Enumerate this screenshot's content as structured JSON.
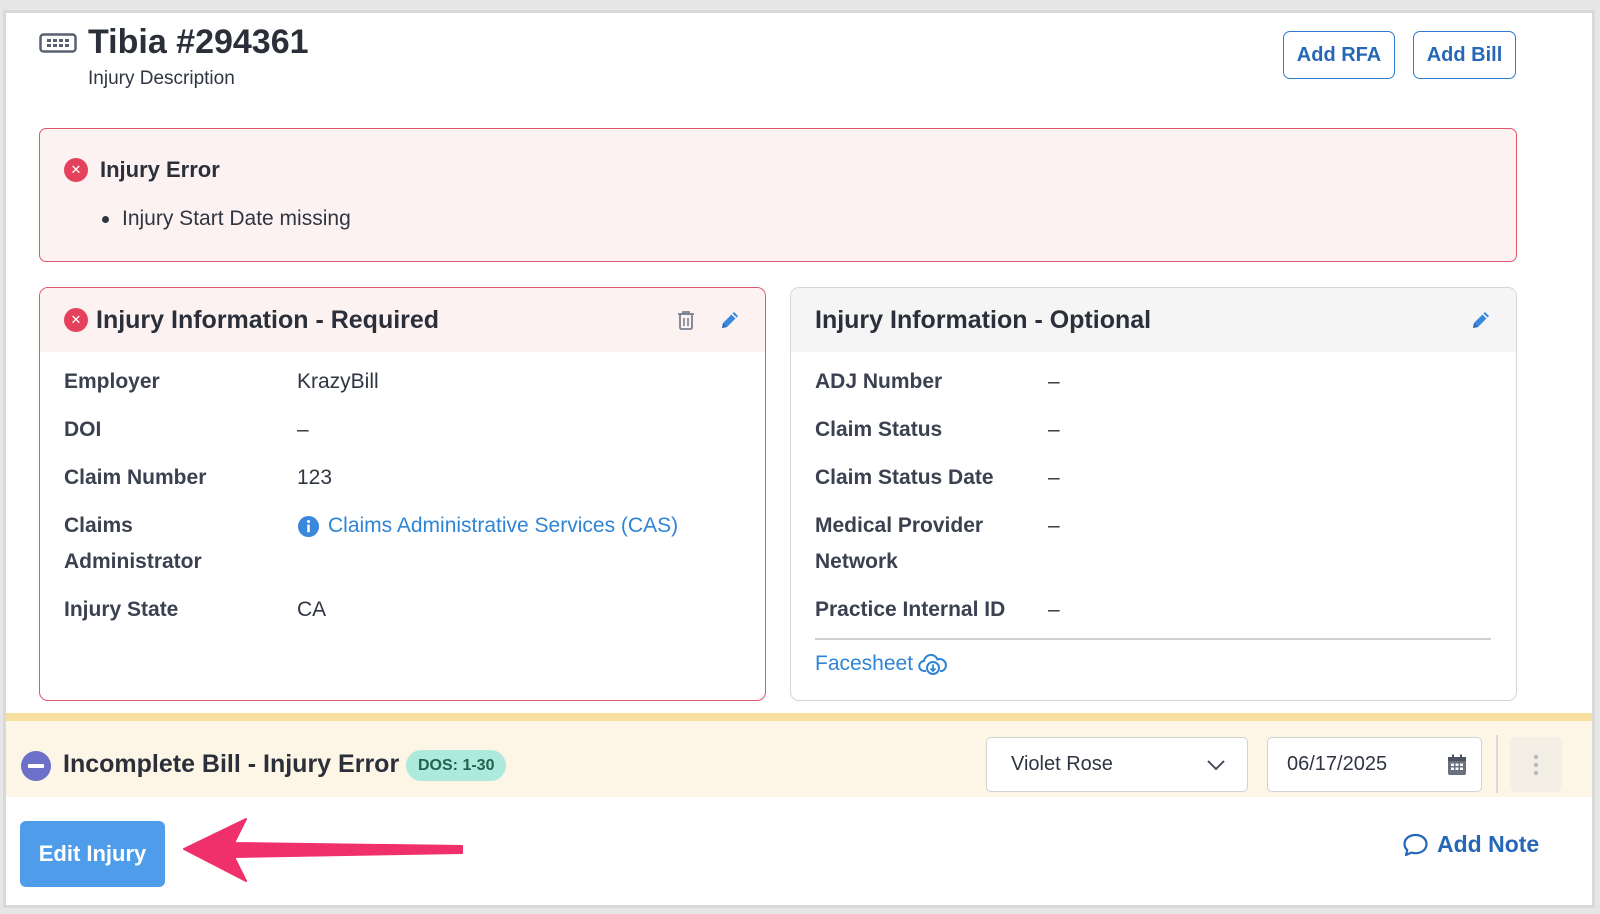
{
  "header": {
    "icon": "id-card-icon",
    "title": "Tibia #294361",
    "subtitle": "Injury Description",
    "add_rfa_label": "Add RFA",
    "add_bill_label": "Add Bill"
  },
  "error_banner": {
    "icon": "error-x-icon",
    "title": "Injury Error",
    "items": [
      "Injury Start Date missing"
    ]
  },
  "required_card": {
    "title": "Injury Information - Required",
    "icons": [
      "error-x-icon",
      "trash-icon",
      "pencil-icon"
    ],
    "rows": [
      {
        "label": "Employer",
        "value": "KrazyBill"
      },
      {
        "label": "DOI",
        "value": "–"
      },
      {
        "label": "Claim Number",
        "value": "123"
      },
      {
        "label_line1": "Claims",
        "label_line2": "Administrator",
        "value": "Claims Administrative Services (CAS)"
      },
      {
        "label": "Injury State",
        "value": "CA"
      }
    ]
  },
  "optional_card": {
    "title": "Injury Information - Optional",
    "icons": [
      "pencil-icon"
    ],
    "rows": [
      {
        "label": "ADJ Number",
        "value": "–"
      },
      {
        "label": "Claim Status",
        "value": "–"
      },
      {
        "label": "Claim Status Date",
        "value": "–"
      },
      {
        "label_line1": "Medical Provider",
        "label_line2": "Network",
        "value": "–"
      },
      {
        "label": "Practice Internal ID",
        "value": "–"
      }
    ],
    "facesheet_label": "Facesheet"
  },
  "bill_bar": {
    "title": "Incomplete Bill - Injury Error",
    "dos_badge": "DOS: 1-30",
    "provider_select": "Violet Rose",
    "date_value": "06/17/2025"
  },
  "footer": {
    "edit_injury_label": "Edit Injury",
    "add_note_label": "Add Note"
  },
  "colors": {
    "accent_blue": "#2e7bd1",
    "error_red": "#e4415c",
    "warning_yellow": "#f7df9f",
    "arrow_pink": "#f0306a",
    "dos_green": "#aeeadb"
  }
}
